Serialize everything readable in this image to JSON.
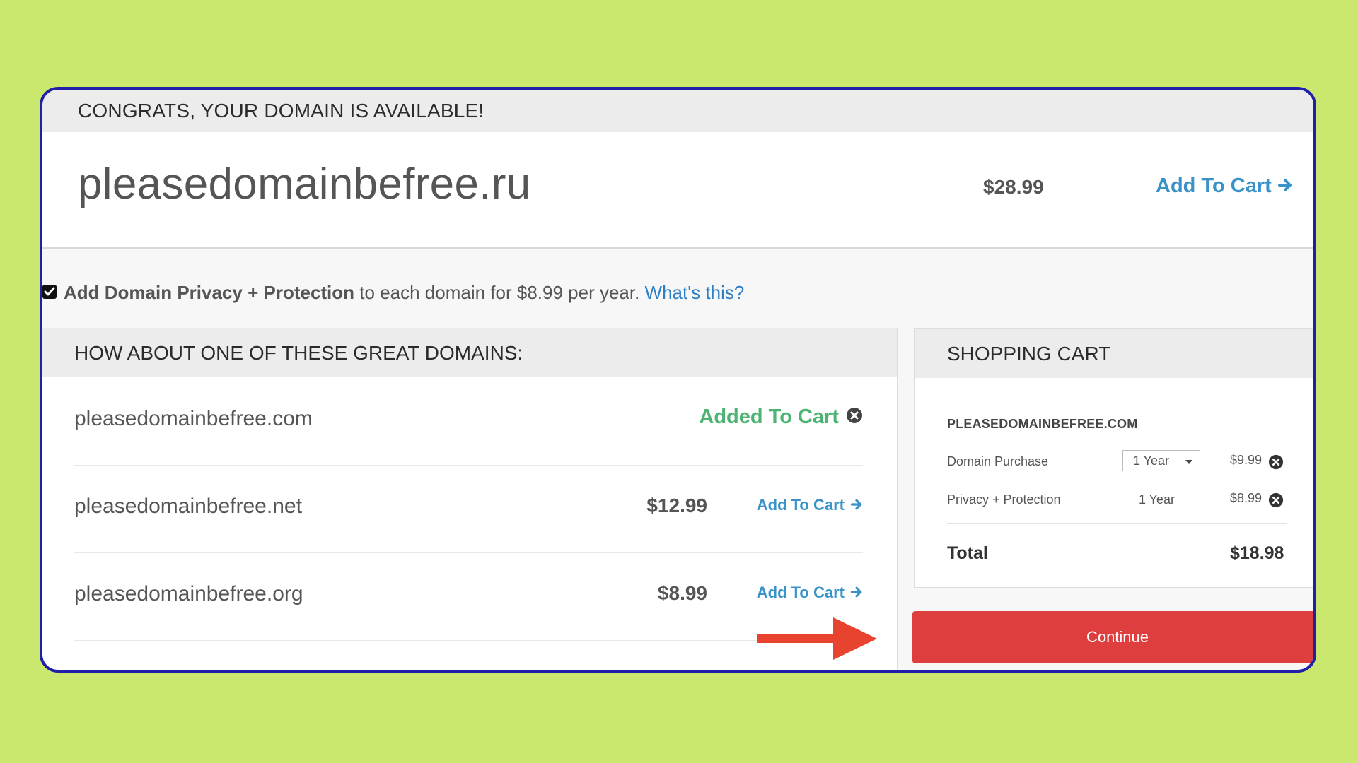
{
  "banner": {
    "text": "CONGRATS, YOUR DOMAIN IS AVAILABLE!"
  },
  "main_domain": {
    "name": "pleasedomainbefree.ru",
    "price": "$28.99",
    "add_label": "Add To Cart"
  },
  "privacy": {
    "checked": true,
    "bold_text": "Add Domain Privacy + Protection",
    "text": " to each domain for $8.99 per year. ",
    "link": "What's this?"
  },
  "suggestions": {
    "title": "HOW ABOUT ONE OF THESE GREAT DOMAINS:",
    "rows": [
      {
        "name": "pleasedomainbefree.com",
        "status": "Added To Cart"
      },
      {
        "name": "pleasedomainbefree.net",
        "price": "$12.99",
        "add_label": "Add To Cart"
      },
      {
        "name": "pleasedomainbefree.org",
        "price": "$8.99",
        "add_label": "Add To Cart"
      }
    ]
  },
  "cart": {
    "title": "SHOPPING CART",
    "domain": "PLEASEDOMAINBEFREE.COM",
    "lines": [
      {
        "label": "Domain Purchase",
        "term": "1 Year",
        "price": "$9.99"
      },
      {
        "label": "Privacy + Protection",
        "term": "1 Year",
        "price": "$8.99"
      }
    ],
    "total_label": "Total",
    "total_value": "$18.98"
  },
  "continue_label": "Continue",
  "colors": {
    "background": "#cbe86e",
    "frame_border": "#1f1fa8",
    "link_blue": "#3a93c8",
    "added_green": "#4db373",
    "continue_red": "#de3e3e",
    "arrow_red": "#e8432f"
  },
  "icons": [
    "arrow-right-icon",
    "remove-circle-icon",
    "checkbox-checked-icon",
    "chevron-down-icon",
    "red-arrow-annotation"
  ]
}
